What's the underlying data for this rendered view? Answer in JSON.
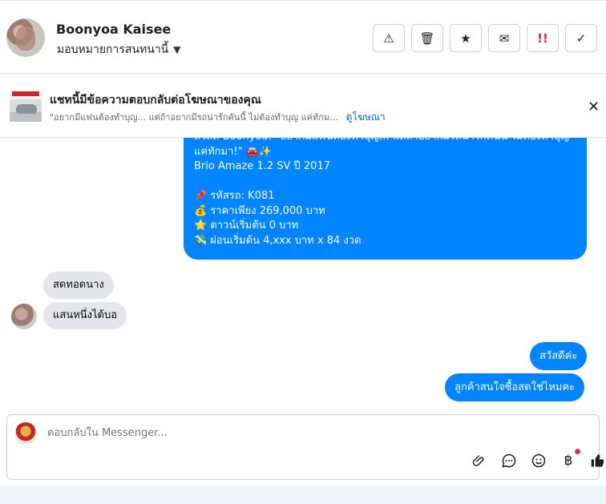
{
  "header": {
    "name": "Boonyoa Kaisee",
    "assign_label": "มอบหมายการสนทนานี้",
    "actions": [
      {
        "name": "warning-button",
        "icon": "⚠"
      },
      {
        "name": "delete-button",
        "icon": "🗑"
      },
      {
        "name": "star-button",
        "icon": "★"
      },
      {
        "name": "mail-button",
        "icon": "✉"
      },
      {
        "name": "important-button",
        "icon": "!!"
      },
      {
        "name": "done-button",
        "icon": "✓"
      }
    ]
  },
  "ad": {
    "title": "แชทนี้มีข้อความตอบกลับต่อโฆษณาของคุณ",
    "excerpt": "\"อยากมีแฟนต้องทำบุญ... แต่ถ้าอยากมีรถน่ารักคันนี้ ไม่ต้องทำบุญ แค่ทักม...",
    "link": "ดูโฆษณา",
    "close_icon": "✕"
  },
  "messages": {
    "ad_message_lines": [
      "สวัสดี Boonyoa! \"อยากมีแฟนต้องทำบุญ... แต่ถ้าอยากมีรถน่ารักคันนี้ ไม่ต้องทำบุญ",
      "แค่ทักมา!\" 🚘✨",
      "Brio Amaze 1.2 SV ปี 2017",
      "",
      "📌 รหัสรถ: K081",
      "💰 ราคาเพียง 269,000 บาท",
      "⭐ ดาวน์เริ่มต้น 0 บาท",
      "💸 ผ่อนเริ่มต้น 4,xxx บาท x 84 งวด"
    ],
    "incoming": [
      "สดทอดนาง",
      "แสนหนึ่งได้บอ"
    ],
    "outgoing": [
      "สวัสดีค่ะ",
      "ลูกค้าสนใจซื้อสดใช่ไหมคะ"
    ]
  },
  "composer": {
    "placeholder": "ตอบกลับใน Messenger...",
    "icons": [
      "paperclip-icon",
      "chat-icon",
      "emoji-icon",
      "baht-icon",
      "thumbs-up-icon"
    ]
  },
  "colors": {
    "accent": "#0084ff",
    "incoming_bg": "#e4e6eb"
  }
}
